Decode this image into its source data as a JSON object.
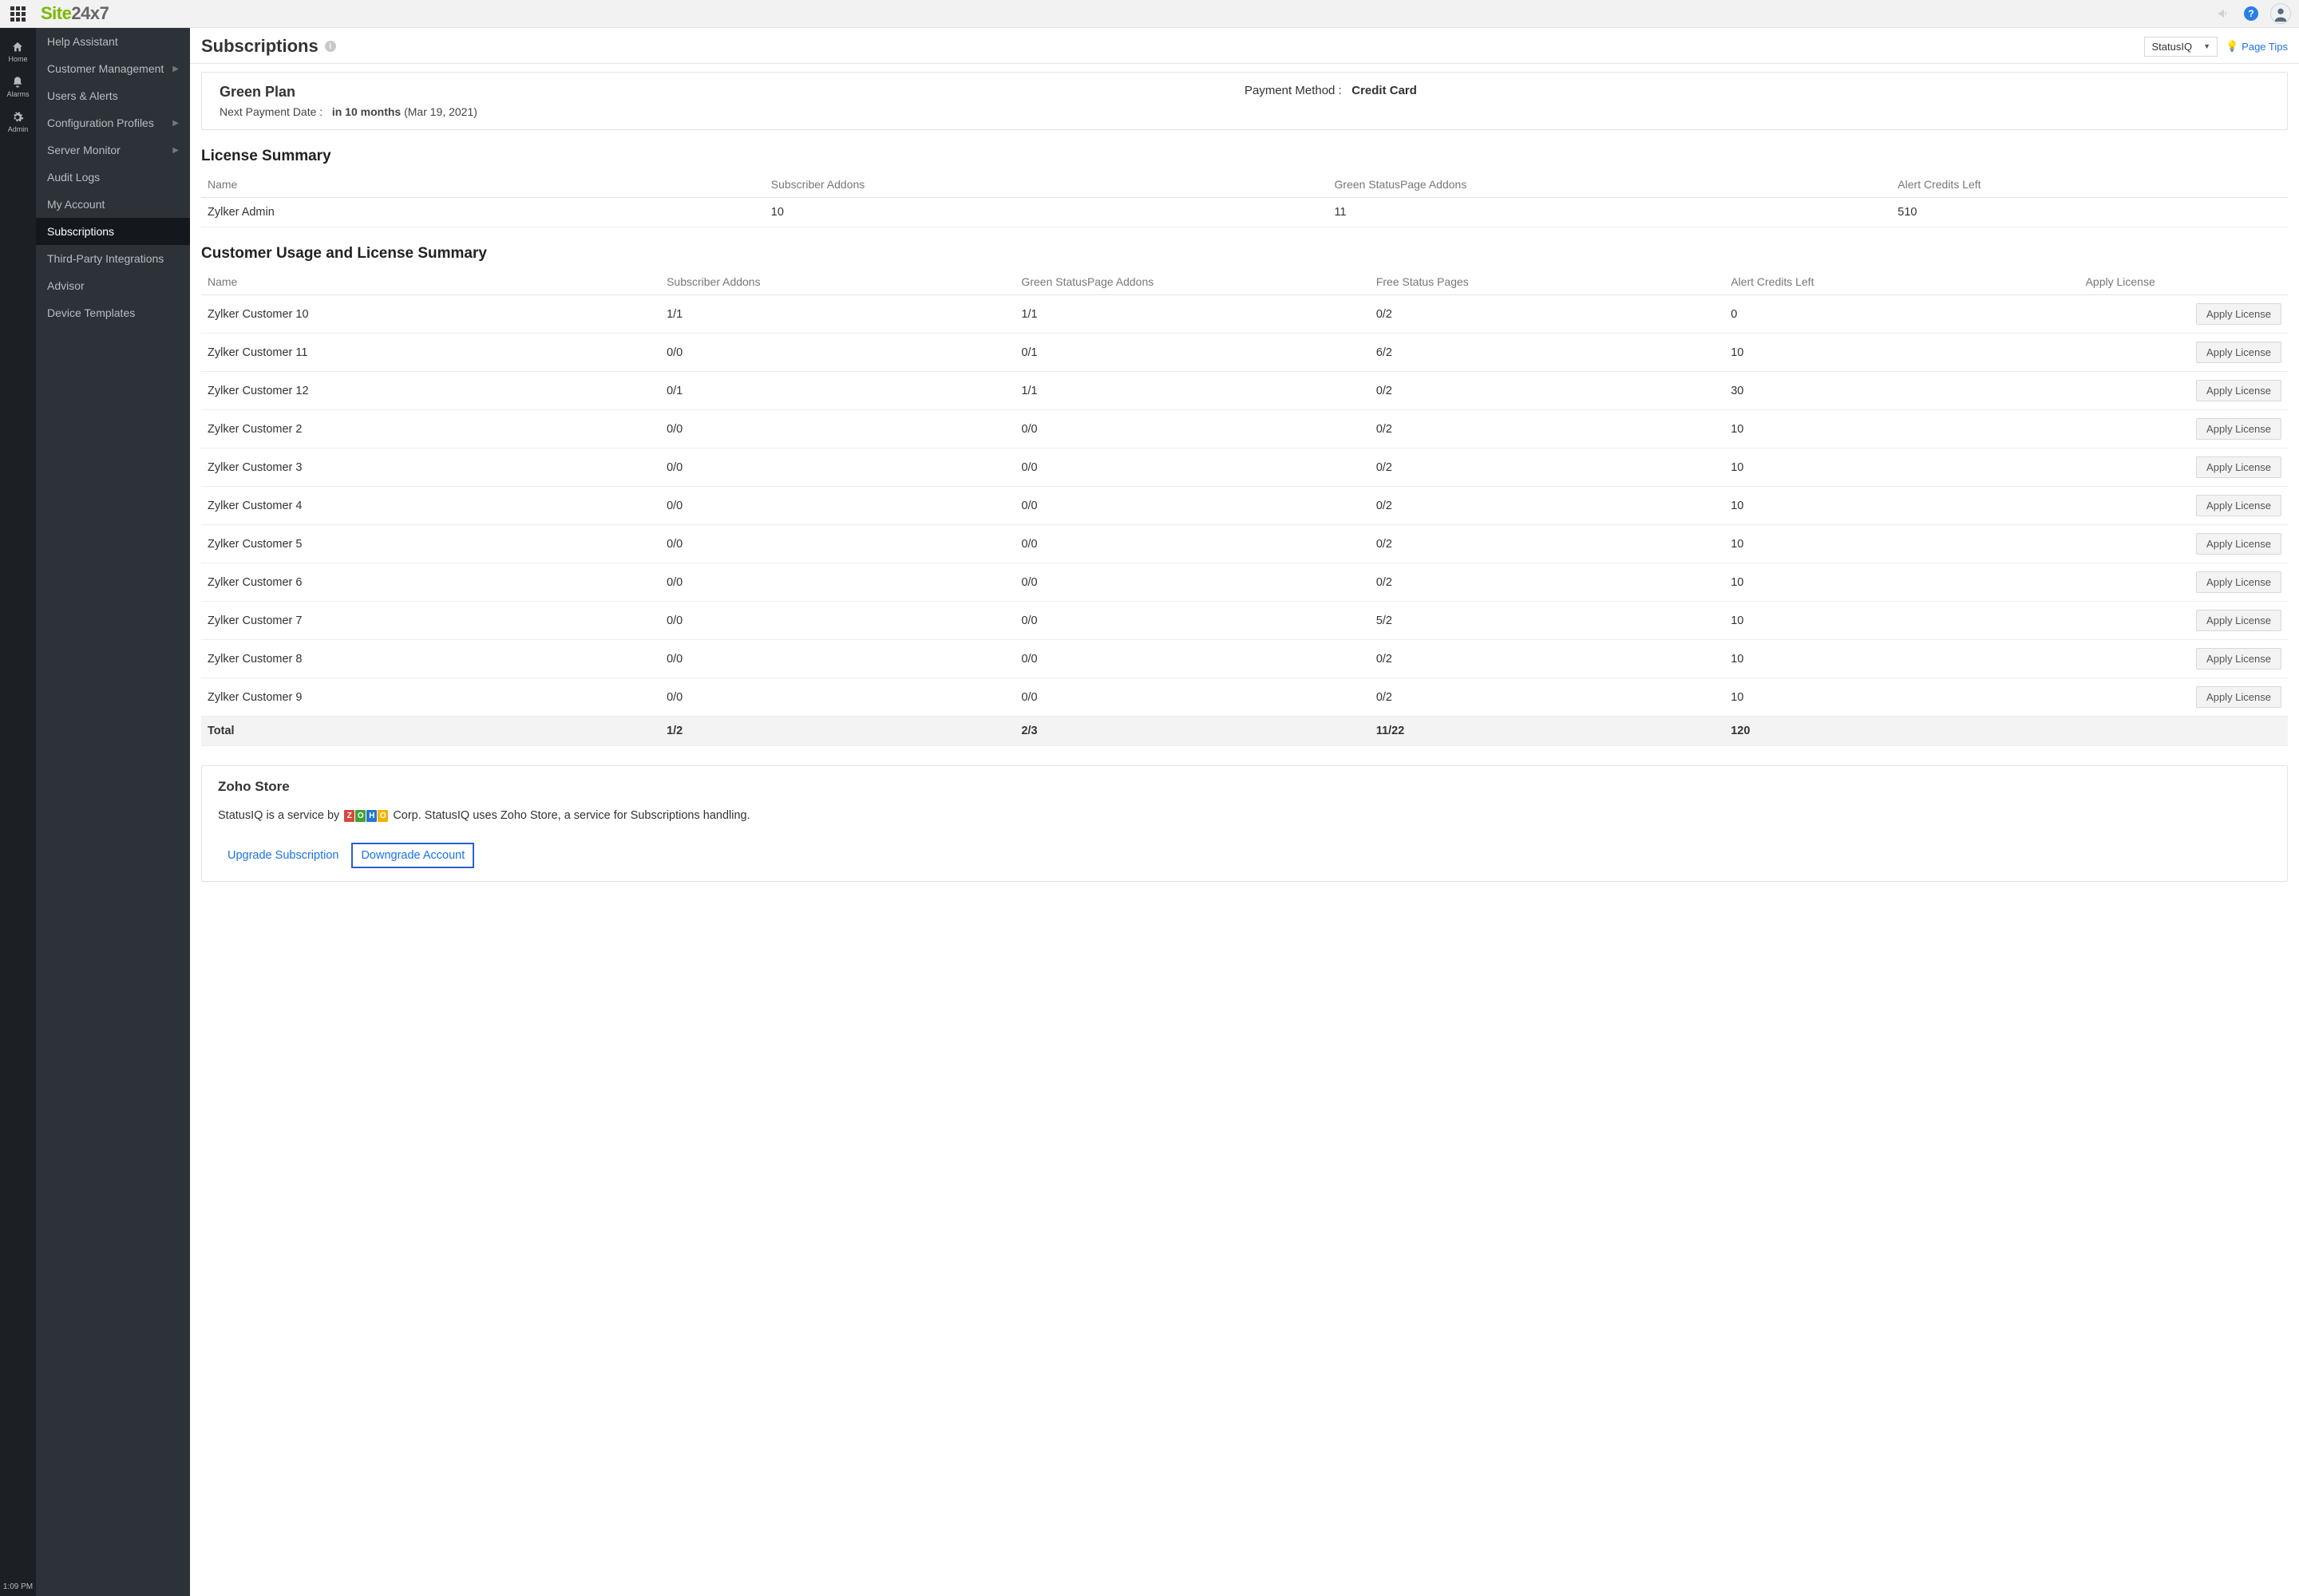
{
  "header": {
    "logo_green": "Site",
    "logo_rest": "24x7"
  },
  "rail": {
    "items": [
      {
        "icon": "home",
        "label": "Home"
      },
      {
        "icon": "bell",
        "label": "Alarms"
      },
      {
        "icon": "gear",
        "label": "Admin"
      }
    ],
    "time": "1:09 PM"
  },
  "sidebar": {
    "items": [
      {
        "label": "Help Assistant",
        "sub": false
      },
      {
        "label": "Customer Management",
        "sub": true
      },
      {
        "label": "Users & Alerts",
        "sub": false
      },
      {
        "label": "Configuration Profiles",
        "sub": true
      },
      {
        "label": "Server Monitor",
        "sub": true
      },
      {
        "label": "Audit Logs",
        "sub": false
      },
      {
        "label": "My Account",
        "sub": false
      },
      {
        "label": "Subscriptions",
        "sub": false,
        "active": true
      },
      {
        "label": "Third-Party Integrations",
        "sub": false
      },
      {
        "label": "Advisor",
        "sub": false
      },
      {
        "label": "Device Templates",
        "sub": false
      }
    ]
  },
  "page": {
    "title": "Subscriptions",
    "selector": "StatusIQ",
    "page_tips": "Page Tips"
  },
  "plan": {
    "name": "Green Plan",
    "next_label": "Next Payment Date :",
    "next_value": "in 10 months",
    "next_paren": "(Mar 19, 2021)",
    "pay_label": "Payment Method :",
    "pay_value": "Credit Card"
  },
  "license_summary": {
    "title": "License Summary",
    "cols": [
      "Name",
      "Subscriber Addons",
      "Green StatusPage Addons",
      "Alert Credits Left"
    ],
    "row": {
      "name": "Zylker Admin",
      "sub": "10",
      "green": "11",
      "alert": "510"
    }
  },
  "usage": {
    "title": "Customer Usage and License Summary",
    "cols": [
      "Name",
      "Subscriber Addons",
      "Green StatusPage Addons",
      "Free Status Pages",
      "Alert Credits Left",
      "Apply License"
    ],
    "apply_label": "Apply License",
    "rows": [
      {
        "name": "Zylker Customer 10",
        "sub": "1/1",
        "green": "1/1",
        "free": "0/2",
        "alert": "0"
      },
      {
        "name": "Zylker Customer 11",
        "sub": "0/0",
        "green": "0/1",
        "free": "6/2",
        "free_over": true,
        "alert": "10"
      },
      {
        "name": "Zylker Customer 12",
        "sub": "0/1",
        "green": "1/1",
        "free": "0/2",
        "alert": "30"
      },
      {
        "name": "Zylker Customer 2",
        "sub": "0/0",
        "green": "0/0",
        "free": "0/2",
        "alert": "10"
      },
      {
        "name": "Zylker Customer 3",
        "sub": "0/0",
        "green": "0/0",
        "free": "0/2",
        "alert": "10"
      },
      {
        "name": "Zylker Customer 4",
        "sub": "0/0",
        "green": "0/0",
        "free": "0/2",
        "alert": "10"
      },
      {
        "name": "Zylker Customer 5",
        "sub": "0/0",
        "green": "0/0",
        "free": "0/2",
        "alert": "10"
      },
      {
        "name": "Zylker Customer 6",
        "sub": "0/0",
        "green": "0/0",
        "free": "0/2",
        "alert": "10"
      },
      {
        "name": "Zylker Customer 7",
        "sub": "0/0",
        "green": "0/0",
        "free": "5/2",
        "free_over": true,
        "alert": "10"
      },
      {
        "name": "Zylker Customer 8",
        "sub": "0/0",
        "green": "0/0",
        "free": "0/2",
        "alert": "10"
      },
      {
        "name": "Zylker Customer 9",
        "sub": "0/0",
        "green": "0/0",
        "free": "0/2",
        "alert": "10"
      }
    ],
    "total": {
      "label": "Total",
      "sub": "1/2",
      "green": "2/3",
      "free": "11/22",
      "alert": "120"
    }
  },
  "store": {
    "title": "Zoho Store",
    "desc_pre": "StatusIQ is a service by",
    "desc_post": "Corp.  StatusIQ uses Zoho Store, a service for Subscriptions handling.",
    "upgrade": "Upgrade Subscription",
    "downgrade": "Downgrade Account"
  }
}
